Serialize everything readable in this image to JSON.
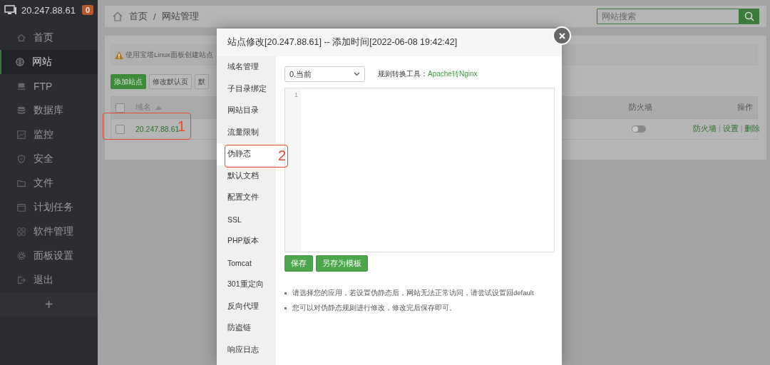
{
  "header": {
    "ip": "20.247.88.61",
    "badge": "0"
  },
  "sidebar": {
    "items": [
      {
        "label": "首页",
        "selected": false
      },
      {
        "label": "网站",
        "selected": true
      },
      {
        "label": "FTP",
        "selected": false
      },
      {
        "label": "数据库",
        "selected": false
      },
      {
        "label": "监控",
        "selected": false
      },
      {
        "label": "安全",
        "selected": false
      },
      {
        "label": "文件",
        "selected": false
      },
      {
        "label": "计划任务",
        "selected": false
      },
      {
        "label": "软件管理",
        "selected": false
      },
      {
        "label": "面板设置",
        "selected": false
      },
      {
        "label": "退出",
        "selected": false
      }
    ],
    "add_label": "+"
  },
  "breadcrumb": {
    "items": [
      "首页",
      "网站管理"
    ],
    "separator": "/"
  },
  "search": {
    "placeholder": "网站搜索"
  },
  "notice": "使用宝塔Linux面板创建站点",
  "toolbar": [
    {
      "label": "添加站点",
      "kind": "primary"
    },
    {
      "label": "修改默认页",
      "kind": "default"
    },
    {
      "label": "默",
      "kind": "default"
    }
  ],
  "table": {
    "header_checked": false,
    "columns": [
      "域名",
      "防火墙",
      "操作"
    ],
    "rows": [
      {
        "checked": false,
        "domain": "20.247.88.61",
        "firewall_on": false,
        "actions": [
          "防火墙",
          "设置",
          "删除"
        ]
      }
    ],
    "action_separator": "|"
  },
  "modal": {
    "title": "站点修改[20.247.88.61] -- 添加时间[2022-06-08 19:42:42]",
    "tabs": [
      {
        "label": "域名管理",
        "selected": false
      },
      {
        "label": "子目录绑定",
        "selected": false
      },
      {
        "label": "网站目录",
        "selected": false
      },
      {
        "label": "流量限制",
        "selected": false
      },
      {
        "label": "伪静态",
        "selected": true
      },
      {
        "label": "默认文档",
        "selected": false
      },
      {
        "label": "配置文件",
        "selected": false
      },
      {
        "label": "SSL",
        "selected": false
      },
      {
        "label": "PHP版本",
        "selected": false
      },
      {
        "label": "Tomcat",
        "selected": false
      },
      {
        "label": "301重定向",
        "selected": false
      },
      {
        "label": "反向代理",
        "selected": false
      },
      {
        "label": "防盗链",
        "selected": false
      },
      {
        "label": "响应日志",
        "selected": false
      }
    ],
    "select_value": "0.当前",
    "tool_label": "规则转换工具：",
    "tool_link": "Apache转Nginx",
    "line_numbers": [
      "1"
    ],
    "buttons": [
      "保存",
      "另存为模板"
    ],
    "tips": [
      "请选择您的应用，若设置伪静态后，网站无法正常访问，请尝试设置回default",
      "您可以对伪静态规则进行修改，修改完后保存即可。"
    ]
  },
  "annotations": [
    {
      "label": "1"
    },
    {
      "label": "2"
    }
  ]
}
